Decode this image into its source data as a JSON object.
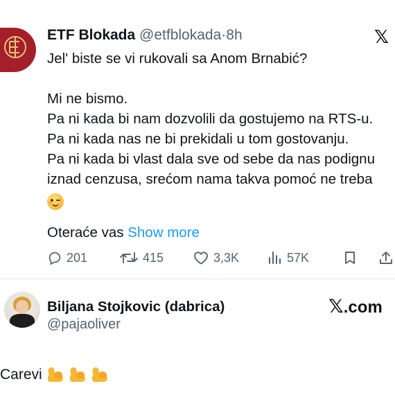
{
  "tweet": {
    "author_name": "ETF Blokada",
    "handle": "@etfblokada",
    "separator": "·",
    "time": "8h",
    "platform_icon": "x-logo-icon",
    "lines": [
      "Jel' biste se vi rukovali sa Anom Brnabić?",
      "",
      "Mi ne bismo.",
      "Pa ni kada bi nam dozvolili da gostujemo na RTS-u.",
      "Pa ni kada nas ne bi prekidali u tom gostovanju.",
      "Pa ni kada bi vlast dala sve od sebe da nas podignu",
      "iznad cenzusa, srećom nama takva pomoć ne treba"
    ],
    "emoji": "winking-face-emoji",
    "more_prefix": "Oteraće vas",
    "show_more": "Show more",
    "stats": {
      "replies": "201",
      "retweets": "415",
      "likes": "3,3K",
      "views": "57K"
    }
  },
  "post2": {
    "author_name": "Biljana Stojkovic (dabrica)",
    "handle": "@pajaoliver",
    "source_label_x": "𝕏",
    "source_label": ".com",
    "text": "Carevi",
    "emoji": "flexed-biceps-emoji"
  },
  "colors": {
    "text": "#0f1419",
    "secondary": "#536471",
    "link": "#1d9bf0",
    "avatar_bg": "#a3202a"
  }
}
